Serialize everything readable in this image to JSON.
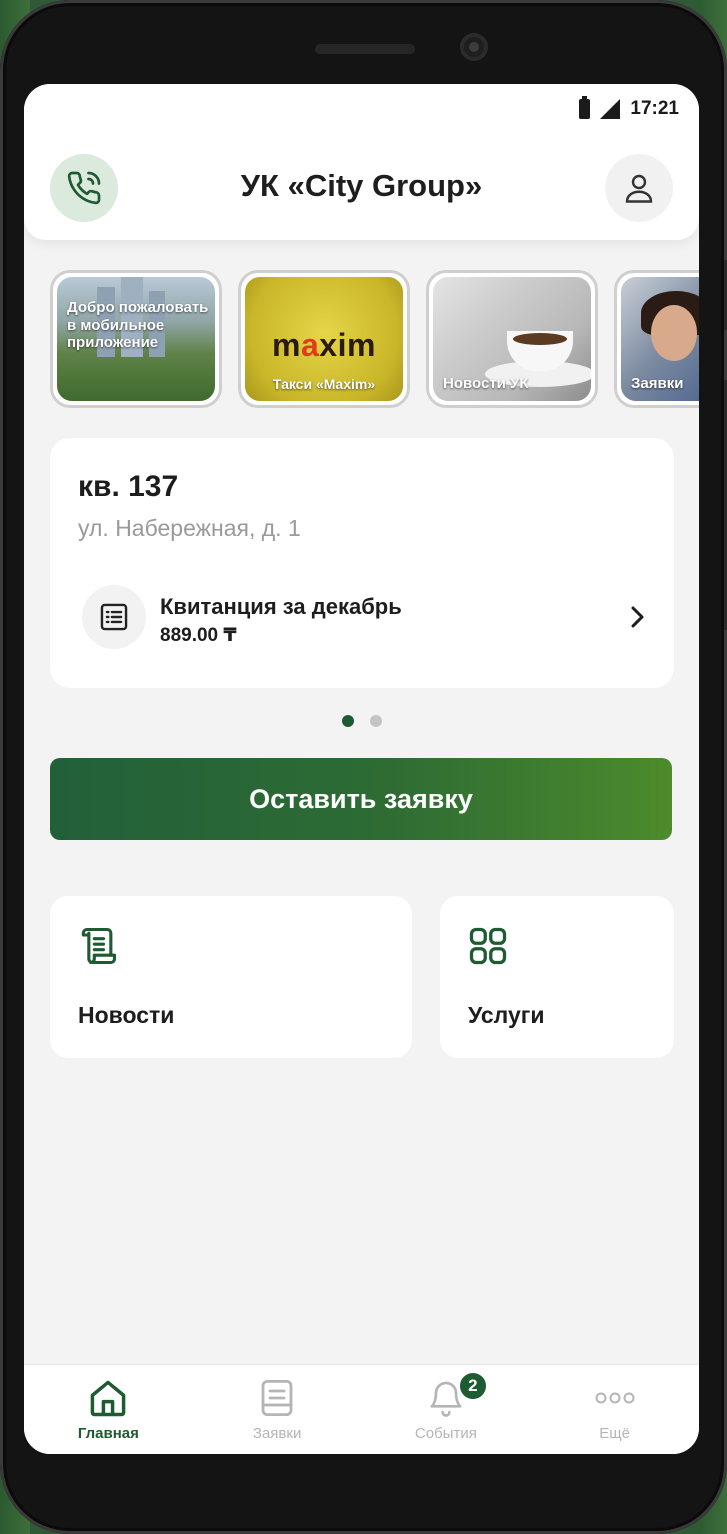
{
  "status_bar": {
    "time": "17:21"
  },
  "header": {
    "title": "УК «City Group»",
    "call_icon": "phone-call-icon",
    "profile_icon": "user-icon"
  },
  "stories": [
    {
      "label": "Добро пожаловать в мобильное приложение"
    },
    {
      "label": "Такси «Maxim»",
      "logo_text": "maxim"
    },
    {
      "label": "Новости УК"
    },
    {
      "label": "Заявки"
    }
  ],
  "account": {
    "apartment": "кв. 137",
    "address": "ул. Набережная, д. 1",
    "invoice_title": "Квитанция за декабрь",
    "invoice_amount": "889.00 ₸"
  },
  "carousel": {
    "count": 2,
    "active_index": 0
  },
  "cta": {
    "label": "Оставить заявку"
  },
  "tiles": [
    {
      "label": "Новости",
      "icon": "scroll-icon"
    },
    {
      "label": "Услуги",
      "icon": "grid-icon"
    }
  ],
  "bottom_nav": {
    "items": [
      {
        "label": "Главная",
        "icon": "home-icon",
        "active": true
      },
      {
        "label": "Заявки",
        "icon": "list-icon",
        "active": false
      },
      {
        "label": "События",
        "icon": "bell-icon",
        "active": false,
        "badge": "2"
      },
      {
        "label": "Ещё",
        "icon": "more-icon",
        "active": false
      }
    ]
  },
  "colors": {
    "accent": "#1f5b32",
    "cta_gradient_end": "#4d8b2c",
    "inactive": "#b5b5b5"
  }
}
